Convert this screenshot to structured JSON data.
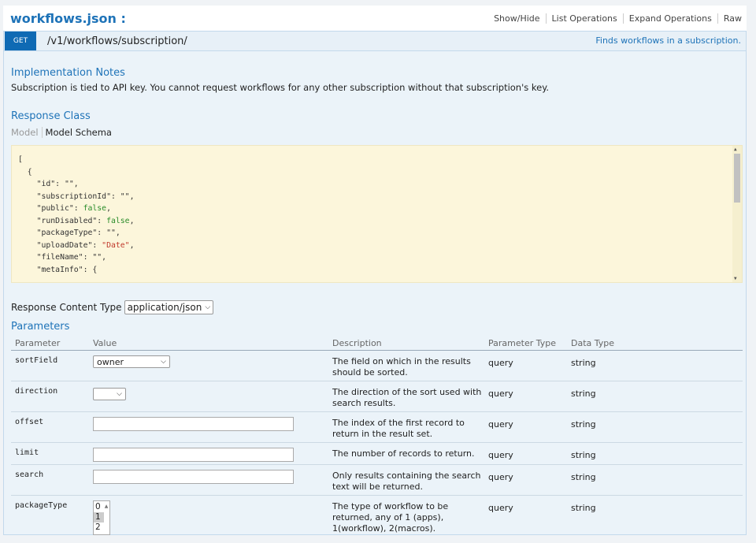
{
  "header": {
    "title": "workflows.json :",
    "links": [
      "Show/Hide",
      "List Operations",
      "Expand Operations",
      "Raw"
    ]
  },
  "operation": {
    "method": "GET",
    "path": "/v1/workflows/subscription/",
    "summary": "Finds workflows in a subscription."
  },
  "implementation": {
    "heading": "Implementation Notes",
    "text": "Subscription is tied to API key. You cannot request workflows for any other subscription without that subscription's key."
  },
  "response_class": {
    "heading": "Response Class",
    "tab_model": "Model",
    "tab_schema": "Model Schema"
  },
  "schema_lines": [
    {
      "text": "["
    },
    {
      "text": "  {"
    },
    {
      "key": "    \"id\": ",
      "val": "\"\"",
      "vtype": "plain",
      "tail": ","
    },
    {
      "key": "    \"subscriptionId\": ",
      "val": "\"\"",
      "vtype": "plain",
      "tail": ","
    },
    {
      "key": "    \"public\": ",
      "val": "false",
      "vtype": "kw",
      "tail": ","
    },
    {
      "key": "    \"runDisabled\": ",
      "val": "false",
      "vtype": "kw",
      "tail": ","
    },
    {
      "key": "    \"packageType\": ",
      "val": "\"\"",
      "vtype": "plain",
      "tail": ","
    },
    {
      "key": "    \"uploadDate\": ",
      "val": "\"Date\"",
      "vtype": "str",
      "tail": ","
    },
    {
      "key": "    \"fileName\": ",
      "val": "\"\"",
      "vtype": "plain",
      "tail": ","
    },
    {
      "key": "    \"metaInfo\": ",
      "val": "{",
      "vtype": "plain",
      "tail": ""
    }
  ],
  "response_content_type": {
    "label": "Response Content Type",
    "value": "application/json"
  },
  "parameters": {
    "heading": "Parameters",
    "columns": [
      "Parameter",
      "Value",
      "Description",
      "Parameter Type",
      "Data Type"
    ],
    "rows": [
      {
        "name": "sortField",
        "control": "select",
        "value": "owner",
        "description": "The field on which in the results should be sorted.",
        "ptype": "query",
        "dtype": "string"
      },
      {
        "name": "direction",
        "control": "select",
        "value": "",
        "description": "The direction of the sort used with search results.",
        "ptype": "query",
        "dtype": "string"
      },
      {
        "name": "offset",
        "control": "text",
        "value": "",
        "description": "The index of the first record to return in the result set.",
        "ptype": "query",
        "dtype": "string"
      },
      {
        "name": "limit",
        "control": "text",
        "value": "",
        "description": "The number of records to return.",
        "ptype": "query",
        "dtype": "string"
      },
      {
        "name": "search",
        "control": "text",
        "value": "",
        "description": "Only results containing the search text will be returned.",
        "ptype": "query",
        "dtype": "string"
      },
      {
        "name": "packageType",
        "control": "listbox",
        "options": [
          "0",
          "1",
          "2"
        ],
        "selected": "1",
        "description": "The type of workflow to be returned, any of 1 (apps), 1(workflow), 2(macros).",
        "ptype": "query",
        "dtype": "string"
      }
    ]
  },
  "icons": {
    "dropdown": "chevron-down-icon",
    "scroll_up": "scroll-up-arrow-icon",
    "scroll_down": "scroll-down-arrow-icon"
  }
}
